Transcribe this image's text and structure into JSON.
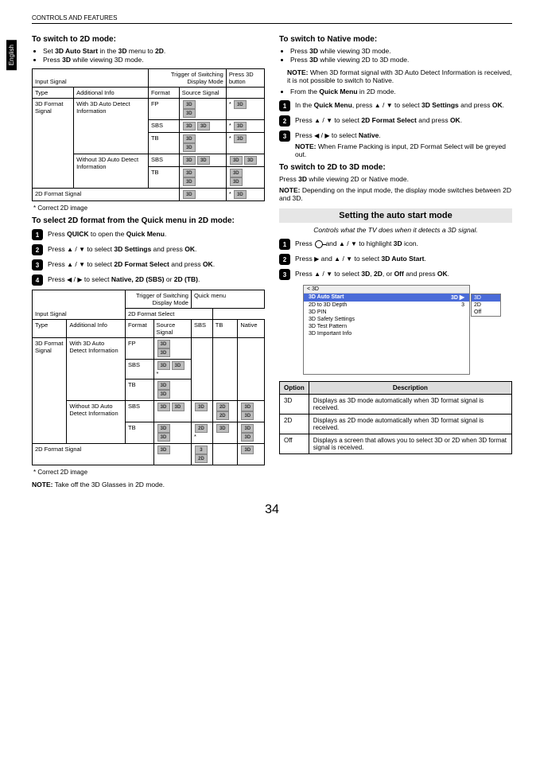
{
  "header": {
    "section": "CONTROLS AND FEATURES",
    "language_tab": "English"
  },
  "page_number": "34",
  "left": {
    "h_switch2d": "To switch to 2D mode:",
    "bul1": "Set ",
    "bul1b": "3D Auto Start",
    "bul1c": " in the ",
    "bul1d": "3D",
    "bul1e": " menu to ",
    "bul1f": "2D",
    "bul1g": ".",
    "bul2a": "Press ",
    "bul2b": "3D",
    "bul2c": " while viewing 3D mode.",
    "table1": {
      "hdr_trigger": "Trigger of Switching Display Mode",
      "hdr_press": "Press 3D button",
      "hdr_input": "Input Signal",
      "cols": {
        "type": "Type",
        "addl": "Additional Info",
        "format": "Format",
        "source": "Source Signal"
      },
      "r1_type": "3D Format Signal",
      "r1_addl_a": "With 3D Auto Detect Information",
      "r1_addl_b": "Without 3D Auto Detect Information",
      "fmt_fp": "FP",
      "fmt_sbs": "SBS",
      "fmt_tb": "TB",
      "row2d": "2D Format Signal"
    },
    "foot_correct2d": "*  Correct 2D image",
    "h_select2d": "To select 2D format from the Quick menu in 2D mode:",
    "steps_a": {
      "s1a": "Press ",
      "s1b": "QUICK",
      "s1c": " to open the ",
      "s1d": "Quick Menu",
      "s1e": ".",
      "s2a": "Press ",
      "s2b": " to select ",
      "s2c": "3D Settings",
      "s2d": " and press ",
      "s2e": "OK",
      "s2f": ".",
      "s3a": "Press ",
      "s3b": " to select ",
      "s3c": "2D Format Select",
      "s3d": " and press ",
      "s3e": "OK",
      "s3f": ".",
      "s4a": "Press ",
      "s4b": " to select ",
      "s4c": "Native, 2D (SBS)",
      "s4d": " or ",
      "s4e": "2D (TB)",
      "s4f": "."
    },
    "table2": {
      "hdr_trigger": "Trigger of Switching Display Mode",
      "hdr_quick": "Quick menu",
      "hdr_input": "Input Signal",
      "hdr_2dfmt": "2D Format Select",
      "cols": {
        "type": "Type",
        "addl": "Additional Info",
        "format": "Format",
        "source": "Source Signal",
        "sbs": "SBS",
        "tb": "TB",
        "native": "Native"
      },
      "r1_type": "3D Format Signal",
      "r1_addl_a": "With 3D Auto Detect Information",
      "r1_addl_b": "Without 3D Auto Detect Information",
      "fmt_fp": "FP",
      "fmt_sbs": "SBS",
      "fmt_tb": "TB",
      "row2d": "2D Format Signal"
    },
    "note_glasses_a": "NOTE:",
    "note_glasses_b": " Take off the 3D Glasses in 2D mode."
  },
  "right": {
    "h_native": "To switch to Native mode:",
    "n_b1a": "Press ",
    "n_b1b": "3D",
    "n_b1c": " while viewing 3D mode.",
    "n_b2a": "Press ",
    "n_b2b": "3D",
    "n_b2c": " while viewing 2D to 3D mode.",
    "n_note_a": "NOTE:",
    "n_note_b": " When 3D format signal with 3D Auto Detect Information is received, it is not possible to switch to Native.",
    "n_b3a": "From the ",
    "n_b3b": "Quick Menu",
    "n_b3c": " in 2D mode.",
    "steps_b": {
      "s1a": "In the ",
      "s1b": "Quick Menu",
      "s1c": ", press ",
      "s1d": " to select ",
      "s1e": "3D Settings",
      "s1f": " and press ",
      "s1g": "OK",
      "s1h": ".",
      "s2a": "Press ",
      "s2b": " to select ",
      "s2c": "2D Format Select",
      "s2d": " and press ",
      "s2e": "OK",
      "s2f": ".",
      "s3a": "Press ",
      "s3b": " to select ",
      "s3c": "Native",
      "s3d": ".",
      "s3note_a": "NOTE:",
      "s3note_b": " When Frame Packing is input, 2D Format Select will be greyed out."
    },
    "h_2dto3d": "To switch to 2D to 3D mode:",
    "p_2dto3d_a": "Press ",
    "p_2dto3d_b": "3D",
    "p_2dto3d_c": " while viewing 2D or Native mode.",
    "p_2dto3d_note_a": "NOTE:",
    "p_2dto3d_note_b": " Depending on the input mode, the display mode switches between 2D and 3D.",
    "band": "Setting the auto start mode",
    "band_sub": "Controls what the TV does when it detects a 3D signal.",
    "steps_c": {
      "s1a": "Press ",
      "s1b": " and ",
      "s1c": " to highlight ",
      "s1d": "3D",
      "s1e": " icon.",
      "s2a": "Press ",
      "s2b": " and ",
      "s2c": " to select ",
      "s2d": "3D Auto Start",
      "s2e": ".",
      "s3a": "Press ",
      "s3b": " to select ",
      "s3c": "3D",
      "s3d": ", ",
      "s3e": "2D",
      "s3f": ", or ",
      "s3g": "Off",
      "s3h": " and press ",
      "s3i": "OK",
      "s3j": "."
    },
    "menu": {
      "crumb": "< 3D",
      "r1_l": "3D Auto Start",
      "r1_r": "3D",
      "r2_l": "2D to 3D Depth",
      "r2_r": "3",
      "r3": "3D PIN",
      "r4": "3D Safety Settings",
      "r5": "3D Test Pattern",
      "r6": "3D Important Info",
      "pop1": "3D",
      "pop2": "2D",
      "pop3": "Off"
    },
    "opt_table": {
      "h1": "Option",
      "h2": "Description",
      "r1a": "3D",
      "r1b": "Displays as 3D mode automatically when 3D format signal is received.",
      "r2a": "2D",
      "r2b": "Displays as 2D mode automatically when 3D format signal is received.",
      "r3a": "Off",
      "r3b": "Displays a screen that allows you to select 3D or 2D when 3D format signal is received."
    }
  }
}
